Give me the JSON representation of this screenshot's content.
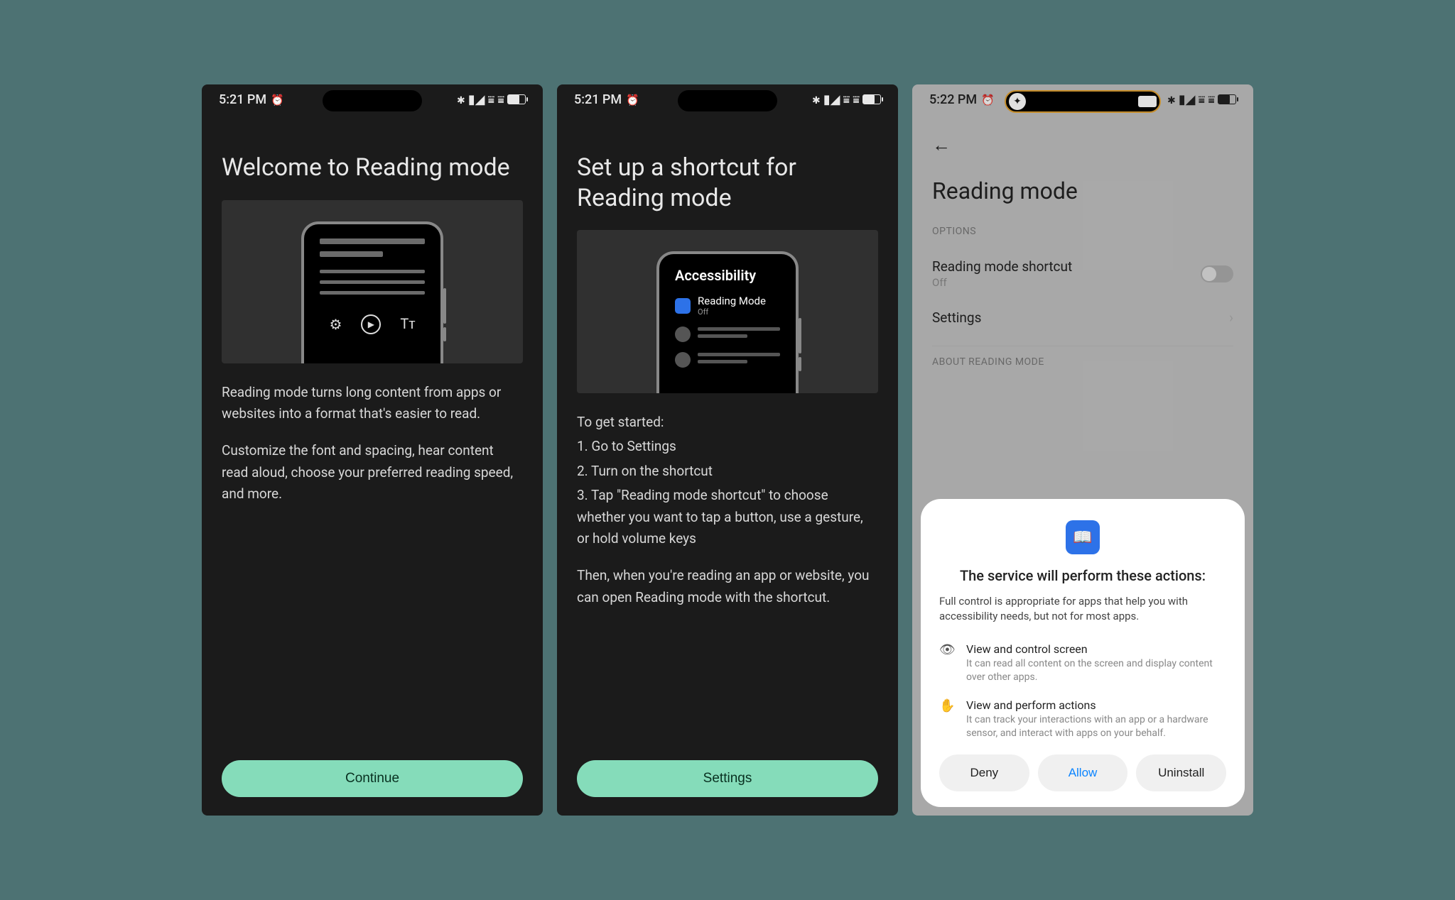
{
  "statusbar": {
    "time1": "5:21 PM",
    "time2": "5:21 PM",
    "time3": "5:22 PM"
  },
  "screen1": {
    "title": "Welcome to Reading mode",
    "p1": "Reading mode turns long content from apps or websites into a format that's easier to read.",
    "p2": "Customize the font and spacing, hear content read aloud, choose your preferred reading speed, and more.",
    "button": "Continue"
  },
  "screen2": {
    "title": "Set up a shortcut for Reading mode",
    "mock_title": "Accessibility",
    "mock_item": "Reading Mode",
    "mock_sub": "Off",
    "intro": "To get started:",
    "step1": "1. Go to Settings",
    "step2": "2. Turn on the shortcut",
    "step3": "3. Tap \"Reading mode shortcut\" to choose whether you want to tap a button, use a gesture, or hold volume keys",
    "p2": "Then, when you're reading an app or website, you can open Reading mode with the shortcut.",
    "button": "Settings"
  },
  "screen3": {
    "title": "Reading mode",
    "section_options": "OPTIONS",
    "row_shortcut": "Reading mode shortcut",
    "row_shortcut_sub": "Off",
    "row_settings": "Settings",
    "section_about": "ABOUT READING MODE",
    "dialog": {
      "title": "The service will perform these actions:",
      "desc": "Full control is appropriate for apps that help you with accessibility needs, but not for most apps.",
      "perm1_title": "View and control screen",
      "perm1_desc": "It can read all content on the screen and display content over other apps.",
      "perm2_title": "View and perform actions",
      "perm2_desc": "It can track your interactions with an app or a hardware sensor, and interact with apps on your behalf.",
      "deny": "Deny",
      "allow": "Allow",
      "uninstall": "Uninstall"
    }
  }
}
